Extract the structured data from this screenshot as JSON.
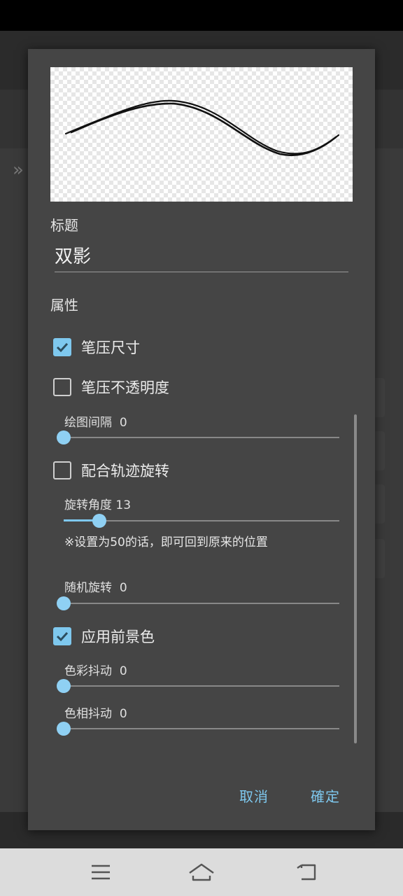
{
  "dialog": {
    "title_label": "标题",
    "title_value": "双影",
    "properties_label": "属性",
    "options": {
      "pressure_size": {
        "label": "笔压尺寸",
        "checked": true
      },
      "pressure_opacity": {
        "label": "笔压不透明度",
        "checked": false
      },
      "rotate_with_path": {
        "label": "配合轨迹旋转",
        "checked": false
      },
      "apply_foreground": {
        "label": "应用前景色",
        "checked": true
      }
    },
    "sliders": {
      "spacing": {
        "label": "绘图间隔",
        "value": "0",
        "fraction": 0.0
      },
      "rotation_angle": {
        "label": "旋转角度",
        "value": "13",
        "fraction": 0.13
      },
      "random_rotation": {
        "label": "随机旋转",
        "value": "0",
        "fraction": 0.0
      },
      "color_jitter": {
        "label": "色彩抖动",
        "value": "0",
        "fraction": 0.0
      },
      "hue_jitter": {
        "label": "色相抖动",
        "value": "0",
        "fraction": 0.0
      }
    },
    "note": "※设置为50的话，即可回到原来的位置",
    "cancel_label": "取消",
    "confirm_label": "確定"
  },
  "colors": {
    "accent": "#7ec8ee",
    "dialog_bg": "#454545"
  },
  "nav": {
    "icons": [
      "menu-icon",
      "home-icon",
      "back-icon"
    ]
  }
}
